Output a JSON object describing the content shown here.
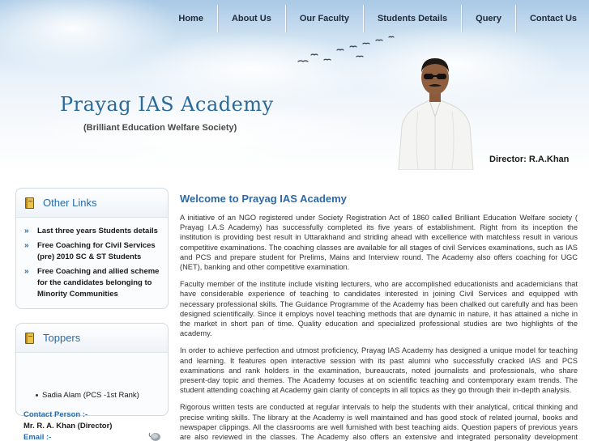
{
  "nav": {
    "items": [
      {
        "label": "Home",
        "name": "nav-home"
      },
      {
        "label": "About Us",
        "name": "nav-about-us"
      },
      {
        "label": "Our Faculty",
        "name": "nav-our-faculty"
      },
      {
        "label": "Students Details",
        "name": "nav-students-details"
      },
      {
        "label": "Query",
        "name": "nav-query"
      },
      {
        "label": "Contact Us",
        "name": "nav-contact-us"
      }
    ]
  },
  "header": {
    "title": "Prayag IAS Academy",
    "subtitle": "(Brilliant Education Welfare Society)",
    "director_caption": "Director: R.A.Khan"
  },
  "sidebar": {
    "other_links": {
      "title": "Other Links",
      "icon": "book-icon",
      "items": [
        "Last three years Students details",
        "Free Coaching for Civil Services (pre) 2010 SC & ST Students",
        "Free Coaching and allied scheme for the candidates belonging to Minority Communities"
      ]
    },
    "toppers": {
      "title": "Toppers",
      "icon": "book-icon",
      "items": [
        "Sadia Alam (PCS -1st Rank)"
      ]
    },
    "contact": {
      "person_label": "Contact Person :-",
      "person_name": "Mr. R. A. Khan (Director)",
      "email_label": "Email :-"
    }
  },
  "main": {
    "heading": "Welcome to Prayag IAS Academy",
    "paragraphs": [
      "A initiative of an NGO registered under Society Registration Act of 1860 called Brilliant Education Welfare society ( Prayag I.A.S Academy) has successfully completed its five years of establishment. Right from its inception the institution is providing best result in Uttarakhand and striding ahead with excellence with matchless result in various competitive examinations. The coaching classes are available for all stages of civil Services examinations, such as IAS and PCS and prepare student for Prelims, Mains and Interview round. The Academy also offers coaching for UGC (NET), banking and other competitive examination.",
      "Faculty member of the institute include visiting lecturers, who are accomplished educationists and academicians that have considerable experience of teaching to candidates interested in joining Civil Services and equipped with necessary professional skills. The Guidance Programme of the Academy has been chalked out carefully and has been designed scientifically. Since it employs novel teaching methods that are dynamic in nature, it has attained a niche in the market in short pan of time. Quality education and specialized professional studies are two highlights of the academy.",
      "In order to achieve perfection and utmost proficiency, Prayag IAS Academy has designed a unique model for teaching and learning. It features open interactive session with its past alumni who successfully cracked IAS and PCS examinations and rank holders in the examination, bureaucrats, noted journalists and professionals, who share present-day topic and themes. The Academy focuses at on scientific teaching and contemporary exam trends. The student attending coaching at Academy gain clarity of concepts in all topics as they go through their in-depth analysis.",
      "Rigorous written tests are conducted at regular intervals to help the students with their analytical, critical thinking and precise writing skills. The library at the Academy is well maintained and has good stock of related journal, books and newspaper clippings. All the classrooms are well furnished with best teaching aids. Question papers of previous years are also reviewed in the classes. The Academy also offers an extensive and integrated personality development programme."
    ]
  },
  "colors": {
    "accent": "#2a6aa8",
    "title": "#2a6a9a",
    "text": "#333333"
  }
}
